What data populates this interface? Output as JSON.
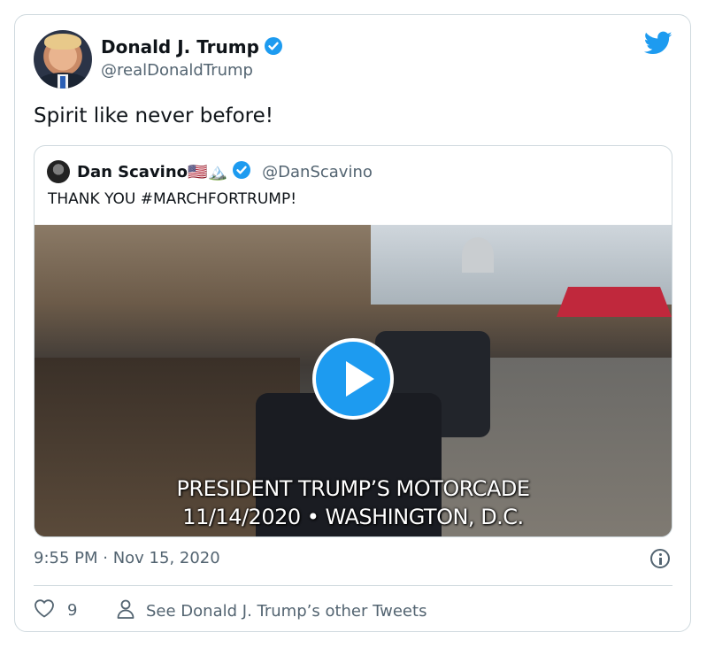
{
  "tweet": {
    "author_name": "Donald J. Trump",
    "author_handle": "@realDonaldTrump",
    "text": "Spirit like never before!",
    "timestamp": "9:55 PM · Nov 15, 2020",
    "icons": {
      "verified": "verified-badge-icon",
      "brand": "twitter-bird-icon",
      "info": "info-icon"
    }
  },
  "quoted": {
    "author_name": "Dan Scavino🇺🇸🏔️",
    "author_handle": "@DanScavino",
    "text": "THANK YOU #MARCHFORTRUMP!",
    "video": {
      "caption_line1": "PRESIDENT TRUMP’S MOTORCADE",
      "caption_line2": "11/14/2020 • WASHINGTON, D.C."
    }
  },
  "actions": {
    "like_count": "9",
    "other_tweets_label": "See Donald J. Trump’s other Tweets"
  },
  "colors": {
    "accent": "#1d9bf0",
    "muted": "#536471",
    "border": "#cfd9de",
    "text": "#0f1419"
  }
}
